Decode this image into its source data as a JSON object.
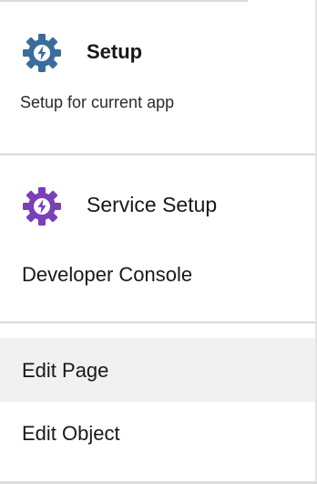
{
  "menu": {
    "setup": {
      "title": "Setup",
      "subtitle": "Setup for current app",
      "icon": "setup-gear-icon",
      "icon_color": "#3a6d9e"
    },
    "service_setup": {
      "title": "Service Setup",
      "icon": "service-setup-gear-icon",
      "icon_color": "#7b3fb8"
    },
    "developer_console": {
      "label": "Developer Console"
    },
    "edit_page": {
      "label": "Edit Page",
      "highlight_color": "#f1f1f1"
    },
    "edit_object": {
      "label": "Edit Object"
    }
  }
}
